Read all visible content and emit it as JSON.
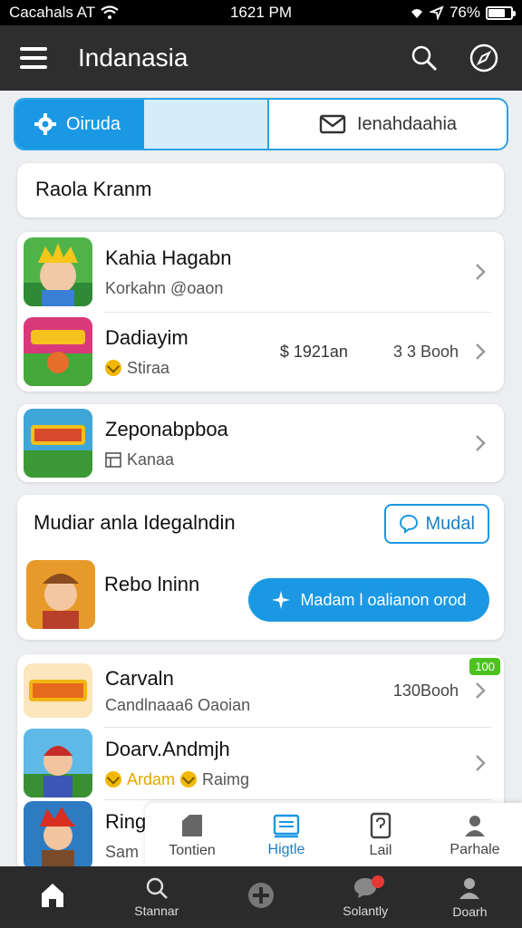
{
  "status_bar": {
    "carrier": "Cacahals AT",
    "time": "1621 PM",
    "battery": "76%"
  },
  "app_bar": {
    "title": "Indanasia"
  },
  "segmented": {
    "left_label": "Oiruda",
    "right_label": "Ienahdaahia"
  },
  "section_title": "Raola Kranm",
  "group1": [
    {
      "title": "Kahia Hagabn",
      "subtitle": "Korkahn @oaon",
      "mid": "",
      "meta": ""
    },
    {
      "title": "Dadiayim",
      "subtitle": "Stiraa",
      "mid": "$ 1921an",
      "meta": "3 3 Booh"
    }
  ],
  "card_single": {
    "title": "Zeponabpboa",
    "subtitle": "Kanaa"
  },
  "featured": {
    "title": "Mudiar anla Idegalndin",
    "outline_button": "Mudal",
    "item_title": "Rebo lninn",
    "cta_button": "Madam l oalianon orod"
  },
  "group2": [
    {
      "title": "Carvaln",
      "subtitle": "Candlnaaa6 Oaoian",
      "meta": "130Booh",
      "badge": "100"
    },
    {
      "title": "Doarv.Andmjh",
      "subtitle_accent": "Ardam",
      "subtitle": "Raimg"
    },
    {
      "title": "Ring",
      "subtitle": "Sam"
    }
  ],
  "popup_tabs": [
    {
      "label": "Tontien",
      "icon": "tag-icon"
    },
    {
      "label": "Higtle",
      "icon": "ticket-icon"
    },
    {
      "label": "Lail",
      "icon": "phone-icon"
    },
    {
      "label": "Parhale",
      "icon": "profile-icon"
    }
  ],
  "bottom_nav": [
    {
      "label": "",
      "icon": "home-icon"
    },
    {
      "label": "Stannar",
      "icon": "search-icon"
    },
    {
      "label": "",
      "icon": "add-icon"
    },
    {
      "label": "Solantly",
      "icon": "chat-icon"
    },
    {
      "label": "Doarh",
      "icon": "account-icon"
    }
  ],
  "colors": {
    "accent": "#1a98e3",
    "appbar": "#2e2e2e",
    "badge": "#4cc31f"
  }
}
